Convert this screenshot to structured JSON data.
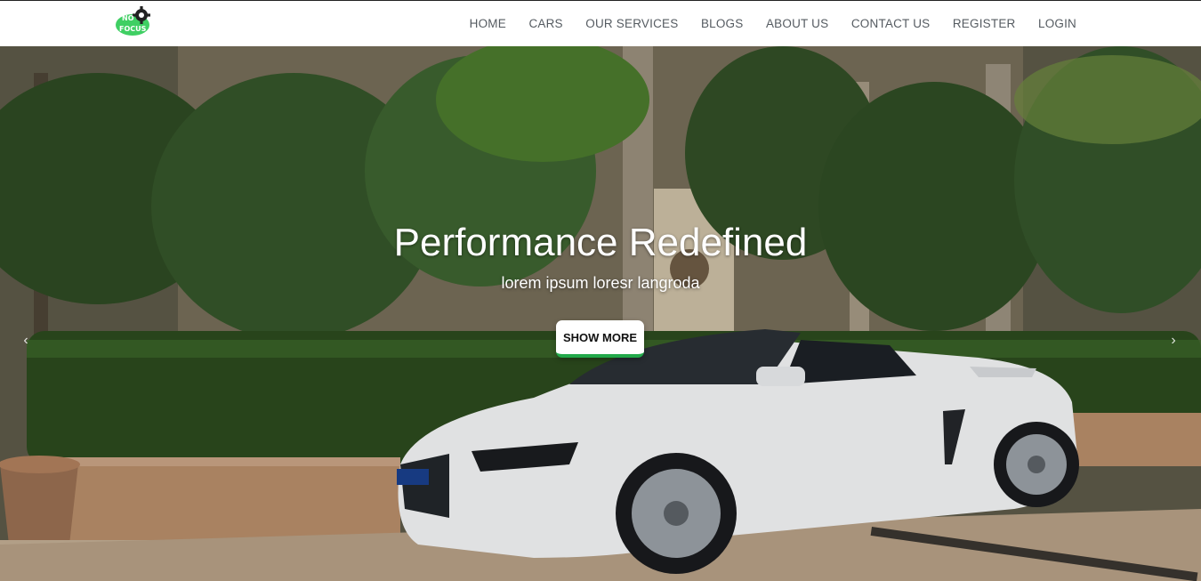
{
  "brand": {
    "logo_text_top": "NO",
    "logo_text_bottom": "FOCUS"
  },
  "nav": {
    "items": [
      {
        "id": "home",
        "label": "HOME"
      },
      {
        "id": "cars",
        "label": "CARS"
      },
      {
        "id": "services",
        "label": "OUR SERVICES"
      },
      {
        "id": "blogs",
        "label": "BLOGS"
      },
      {
        "id": "about",
        "label": "ABOUT US"
      },
      {
        "id": "contact",
        "label": "CONTACT US"
      },
      {
        "id": "register",
        "label": "REGISTER"
      },
      {
        "id": "login",
        "label": "LOGIN"
      }
    ]
  },
  "hero": {
    "title": "Performance Redefined",
    "subtitle": "lorem ipsum loresr langroda",
    "cta_label": "SHOW MORE",
    "prev_arrow": "‹",
    "next_arrow": "›"
  },
  "colors": {
    "accent": "#22a94a",
    "nav_text": "#555b61",
    "car_body": "#f4f5f6"
  },
  "icons": {
    "logo": "gear-logo-icon",
    "prev": "chevron-left-icon",
    "next": "chevron-right-icon"
  }
}
